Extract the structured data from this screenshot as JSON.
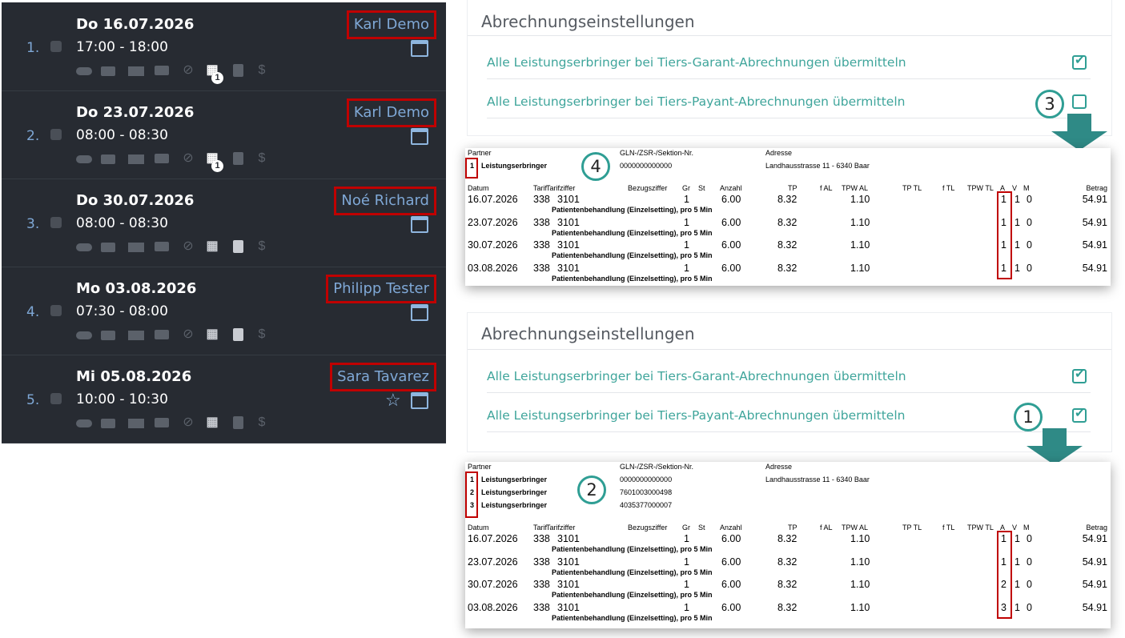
{
  "appointments": [
    {
      "num": "1.",
      "date": "Do 16.07.2026",
      "time": "17:00 - 18:00",
      "name": "Karl Demo",
      "badge": "1",
      "star": false
    },
    {
      "num": "2.",
      "date": "Do 23.07.2026",
      "time": "08:00 - 08:30",
      "name": "Karl Demo",
      "badge": "1",
      "star": false
    },
    {
      "num": "3.",
      "date": "Do 30.07.2026",
      "time": "08:00 - 08:30",
      "name": "Noé Richard",
      "badge": "",
      "star": false
    },
    {
      "num": "4.",
      "date": "Mo 03.08.2026",
      "time": "07:30 - 08:00",
      "name": "Philipp Tester",
      "badge": "",
      "star": false
    },
    {
      "num": "5.",
      "date": "Mi 05.08.2026",
      "time": "10:00 - 10:30",
      "name": "Sara Tavarez",
      "badge": "",
      "star": true
    }
  ],
  "icon_names": [
    "cloud-icon",
    "printer-icon",
    "envelope-icon",
    "chat-icon",
    "blocked-icon",
    "group-icon",
    "calculator-icon",
    "dollar-icon"
  ],
  "star_glyph": "☆",
  "dollar_glyph": "$",
  "blocked_glyph": "⊘",
  "settings": {
    "title": "Abrechnungseinstellungen",
    "tg_label": "Alle Leistungserbringer bei Tiers-Garant-Abrechnungen übermitteln",
    "tp_label": "Alle Leistungserbringer bei Tiers-Payant-Abrechnungen übermitteln"
  },
  "panels": [
    {
      "tg_checked": true,
      "tp_checked": false,
      "marker": "3"
    },
    {
      "tg_checked": true,
      "tp_checked": true,
      "marker": "1"
    }
  ],
  "invoice_headers": {
    "partner": "Partner",
    "gln": "GLN-/ZSR-/Sektion-Nr.",
    "adresse": "Adresse",
    "address_value": "Landhausstrasse 11 - 6340 Baar",
    "columns": [
      "Datum",
      "Tarif",
      "Tarifziffer",
      "Bezugsziffer",
      "Gr",
      "St",
      "Anzahl",
      "TP",
      "f AL",
      "TPW AL",
      "TP TL",
      "f TL",
      "TPW TL",
      "A",
      "V",
      "M",
      "Betrag"
    ]
  },
  "invoices": [
    {
      "marker": "4",
      "partners": [
        {
          "idx": "1",
          "role": "Leistungserbringer",
          "gln": "0000000000000"
        }
      ],
      "rows": [
        {
          "datum": "16.07.2026",
          "tarif": "338",
          "ziffer": "3101",
          "gr": "1",
          "anzahl": "6.00",
          "tp": "8.32",
          "tpwal": "1.10",
          "a": "1",
          "v": "1",
          "m": "0",
          "betrag": "54.91",
          "desc": "Patientenbehandlung (Einzelsetting), pro 5 Min"
        },
        {
          "datum": "23.07.2026",
          "tarif": "338",
          "ziffer": "3101",
          "gr": "1",
          "anzahl": "6.00",
          "tp": "8.32",
          "tpwal": "1.10",
          "a": "1",
          "v": "1",
          "m": "0",
          "betrag": "54.91",
          "desc": "Patientenbehandlung (Einzelsetting), pro 5 Min"
        },
        {
          "datum": "30.07.2026",
          "tarif": "338",
          "ziffer": "3101",
          "gr": "1",
          "anzahl": "6.00",
          "tp": "8.32",
          "tpwal": "1.10",
          "a": "1",
          "v": "1",
          "m": "0",
          "betrag": "54.91",
          "desc": "Patientenbehandlung (Einzelsetting), pro 5 Min"
        },
        {
          "datum": "03.08.2026",
          "tarif": "338",
          "ziffer": "3101",
          "gr": "1",
          "anzahl": "6.00",
          "tp": "8.32",
          "tpwal": "1.10",
          "a": "1",
          "v": "1",
          "m": "0",
          "betrag": "54.91",
          "desc": "Patientenbehandlung (Einzelsetting), pro 5 Min"
        }
      ]
    },
    {
      "marker": "2",
      "partners": [
        {
          "idx": "1",
          "role": "Leistungserbringer",
          "gln": "0000000000000"
        },
        {
          "idx": "2",
          "role": "Leistungserbringer",
          "gln": "7601003000498"
        },
        {
          "idx": "3",
          "role": "Leistungserbringer",
          "gln": "4035377000007"
        }
      ],
      "rows": [
        {
          "datum": "16.07.2026",
          "tarif": "338",
          "ziffer": "3101",
          "gr": "1",
          "anzahl": "6.00",
          "tp": "8.32",
          "tpwal": "1.10",
          "a": "1",
          "v": "1",
          "m": "0",
          "betrag": "54.91",
          "desc": "Patientenbehandlung (Einzelsetting), pro 5 Min"
        },
        {
          "datum": "23.07.2026",
          "tarif": "338",
          "ziffer": "3101",
          "gr": "1",
          "anzahl": "6.00",
          "tp": "8.32",
          "tpwal": "1.10",
          "a": "1",
          "v": "1",
          "m": "0",
          "betrag": "54.91",
          "desc": "Patientenbehandlung (Einzelsetting), pro 5 Min"
        },
        {
          "datum": "30.07.2026",
          "tarif": "338",
          "ziffer": "3101",
          "gr": "1",
          "anzahl": "6.00",
          "tp": "8.32",
          "tpwal": "1.10",
          "a": "2",
          "v": "1",
          "m": "0",
          "betrag": "54.91",
          "desc": "Patientenbehandlung (Einzelsetting), pro 5 Min"
        },
        {
          "datum": "03.08.2026",
          "tarif": "338",
          "ziffer": "3101",
          "gr": "1",
          "anzahl": "6.00",
          "tp": "8.32",
          "tpwal": "1.10",
          "a": "3",
          "v": "1",
          "m": "0",
          "betrag": "54.91",
          "desc": "Patientenbehandlung (Einzelsetting), pro 5 Min"
        }
      ]
    }
  ],
  "colors": {
    "accent": "#2f9e94",
    "highlight": "#c00000",
    "dark_bg": "#272b32",
    "link_blue": "#7fa8d6"
  }
}
